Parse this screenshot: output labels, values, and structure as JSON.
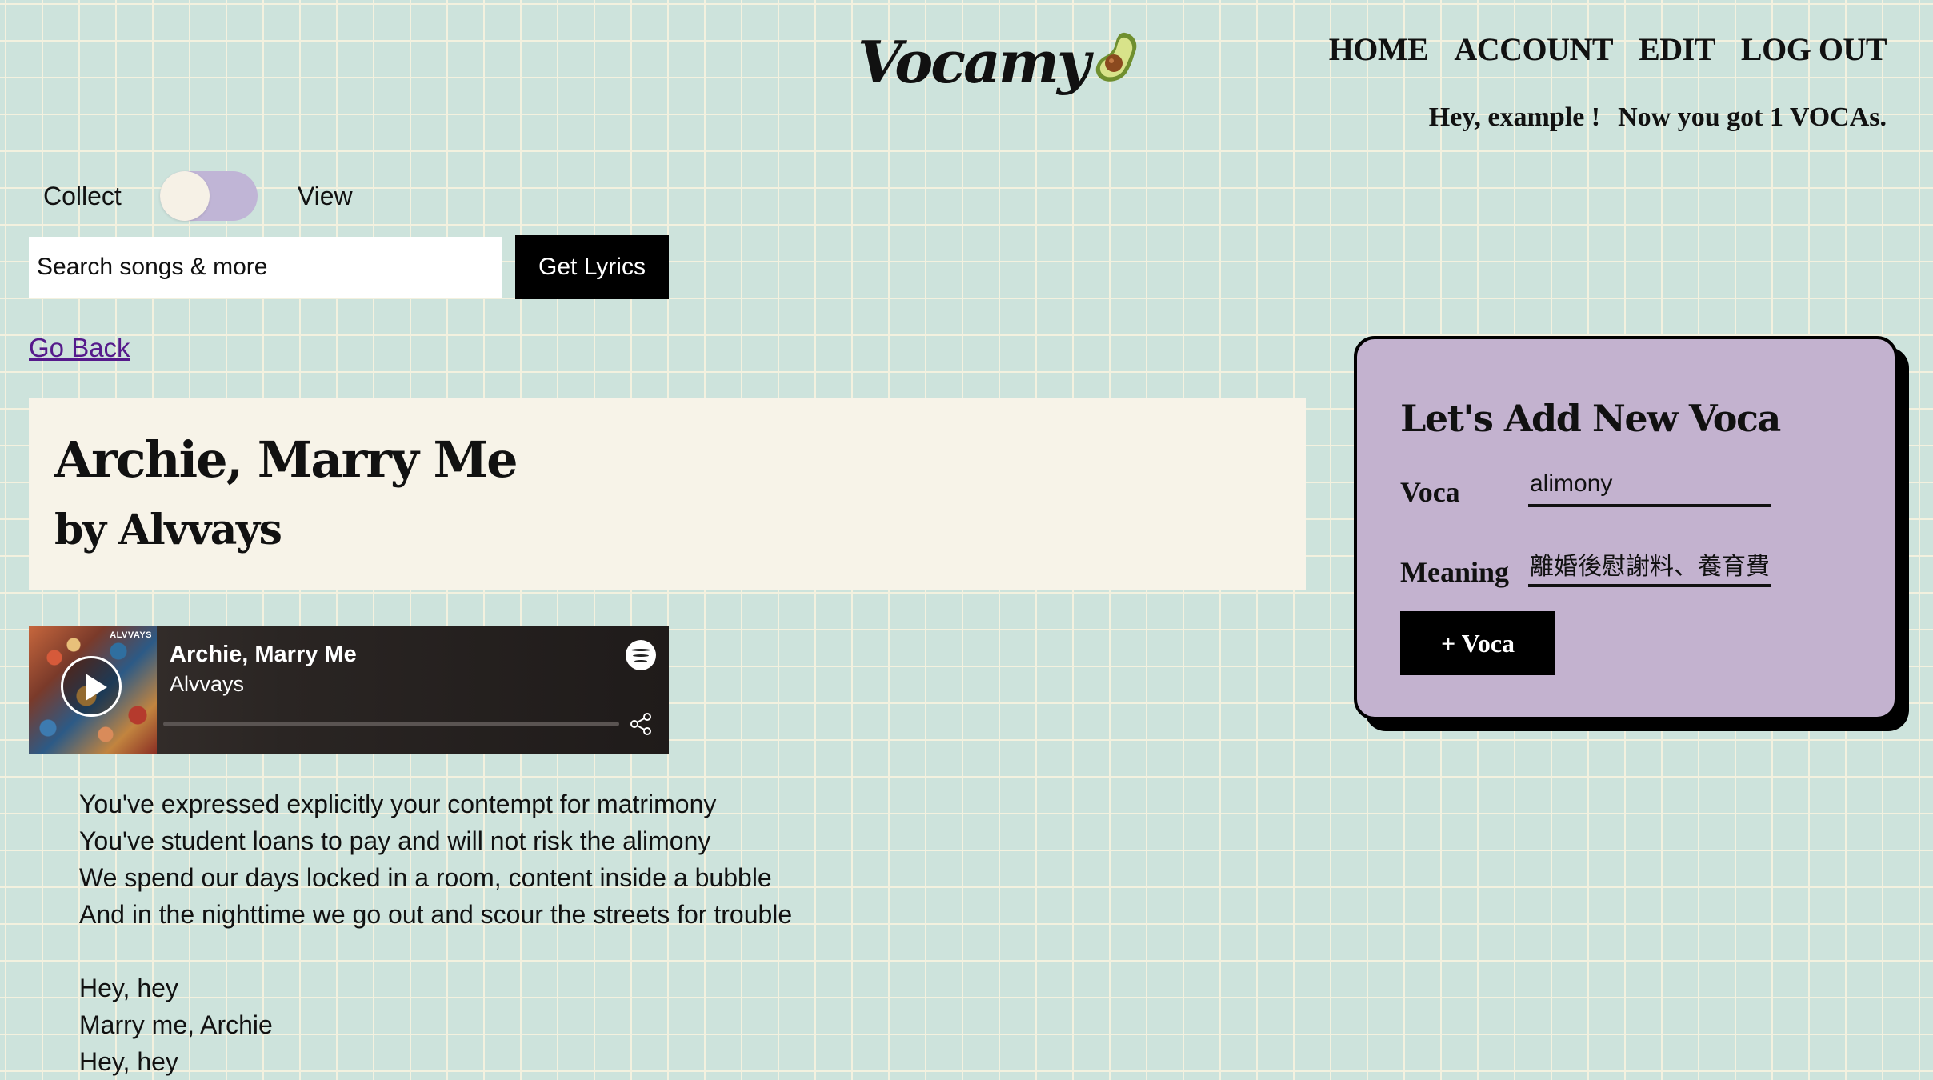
{
  "header": {
    "logo_text": "Vocamy",
    "nav": [
      "HOME",
      "ACCOUNT",
      "EDIT",
      "LOG OUT"
    ],
    "greeting": {
      "hey": "Hey, example !",
      "count_text": "Now you got 1 VOCAs."
    }
  },
  "toggle": {
    "left_label": "Collect",
    "right_label": "View",
    "state": "Collect"
  },
  "search": {
    "placeholder": "Search songs & more",
    "button_label": "Get Lyrics"
  },
  "go_back": "Go Back",
  "song": {
    "title": "Archie, Marry Me",
    "by_line": "by Alvvays"
  },
  "player": {
    "track": "Archie, Marry Me",
    "artist": "Alvvays",
    "cover_label": "ALVVAYS",
    "progress": 0
  },
  "lyrics": [
    "You've expressed explicitly your contempt for matrimony",
    "You've student loans to pay and will not risk the alimony",
    "We spend our days locked in a room, content inside a bubble",
    "And in the nighttime we go out and scour the streets for trouble",
    "",
    "Hey, hey",
    "Marry me, Archie",
    "Hey, hey"
  ],
  "voca_form": {
    "heading": "Let's Add New Voca",
    "voca_label": "Voca",
    "voca_value": "alimony",
    "meaning_label": "Meaning",
    "meaning_value": "離婚後慰謝料、養育費",
    "submit_label": "+ Voca"
  },
  "colors": {
    "background": "#cde3dc",
    "grid_line": "#f3f1df",
    "title_card": "#f7f3e8",
    "voca_card": "#c3b2cf",
    "toggle_track": "#c0b5d6",
    "link": "#551a8b"
  }
}
